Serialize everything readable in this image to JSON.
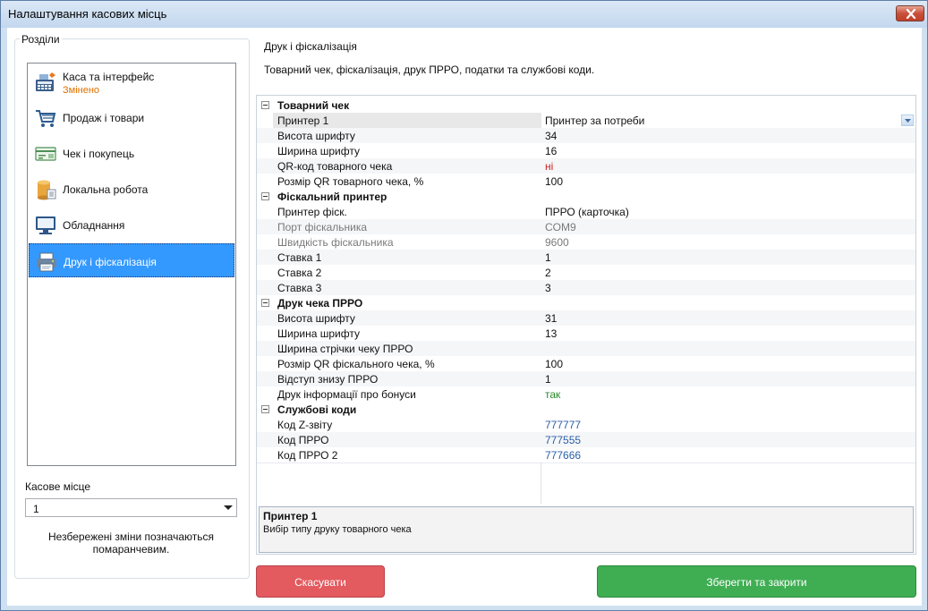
{
  "window": {
    "title": "Налаштування касових місць"
  },
  "sidebar": {
    "group_title": "Розділи",
    "items": [
      {
        "label": "Каса та інтерфейс",
        "sub": "Змінено",
        "icon": "cash-register-icon"
      },
      {
        "label": "Продаж і товари",
        "icon": "shopping-cart-icon"
      },
      {
        "label": "Чек і покупець",
        "icon": "receipt-card-icon"
      },
      {
        "label": "Локальна робота",
        "icon": "database-icon"
      },
      {
        "label": "Обладнання",
        "icon": "monitor-icon"
      },
      {
        "label": "Друк і фіскалізація",
        "icon": "printer-icon"
      }
    ],
    "active_index": 5,
    "pos_label": "Касове місце",
    "pos_value": "1",
    "hint": "Незбережені зміни позначаються помаранчевим."
  },
  "section": {
    "title": "Друк і фіскалізація",
    "description": "Товарний чек, фіскалізація, друк ПРРО, податки та службові коди."
  },
  "grid": {
    "rows": [
      {
        "type": "category",
        "name": "Товарний чек"
      },
      {
        "name": "Принтер 1",
        "value": "Принтер за потреби"
      },
      {
        "name": "Висота шрифту",
        "value": "34"
      },
      {
        "name": "Ширина шрифту",
        "value": "16"
      },
      {
        "name": "QR-код товарного чека",
        "value": "ні"
      },
      {
        "name": "Розмір QR товарного чека, %",
        "value": "100"
      },
      {
        "type": "category",
        "name": "Фіскальний принтер"
      },
      {
        "name": "Принтер фіск.",
        "value": "ПРРО (карточка)"
      },
      {
        "name": "Порт фіскальника",
        "value": "COM9"
      },
      {
        "name": "Швидкість фіскальника",
        "value": "9600"
      },
      {
        "name": "Ставка 1",
        "value": "1"
      },
      {
        "name": "Ставка 2",
        "value": "2"
      },
      {
        "name": "Ставка 3",
        "value": "3"
      },
      {
        "type": "category",
        "name": "Друк чека ПРРО"
      },
      {
        "name": "Висота шрифту",
        "value": "31"
      },
      {
        "name": "Ширина шрифту",
        "value": "13"
      },
      {
        "name": "Ширина стрічки чеку ПРРО",
        "value": ""
      },
      {
        "name": "Розмір QR фіскального чека, %",
        "value": "100"
      },
      {
        "name": "Відступ знизу ПРРО",
        "value": "1"
      },
      {
        "name": "Друк інформації про бонуси",
        "value": "так"
      },
      {
        "type": "category",
        "name": "Службові коди"
      },
      {
        "name": "Код Z-звіту",
        "value": "777777"
      },
      {
        "name": "Код ПРРО",
        "value": "777555"
      },
      {
        "name": "Код ПРРО 2",
        "value": "777666"
      }
    ],
    "description_title": "Принтер 1",
    "description_text": "Вибір типу друку товарного чека"
  },
  "buttons": {
    "cancel": "Скасувати",
    "save": "Зберегти та закрити"
  },
  "colors": {
    "accent": "#3399ff",
    "changed": "#e07000",
    "cancel": "#e35a5f",
    "save": "#3fae53"
  }
}
